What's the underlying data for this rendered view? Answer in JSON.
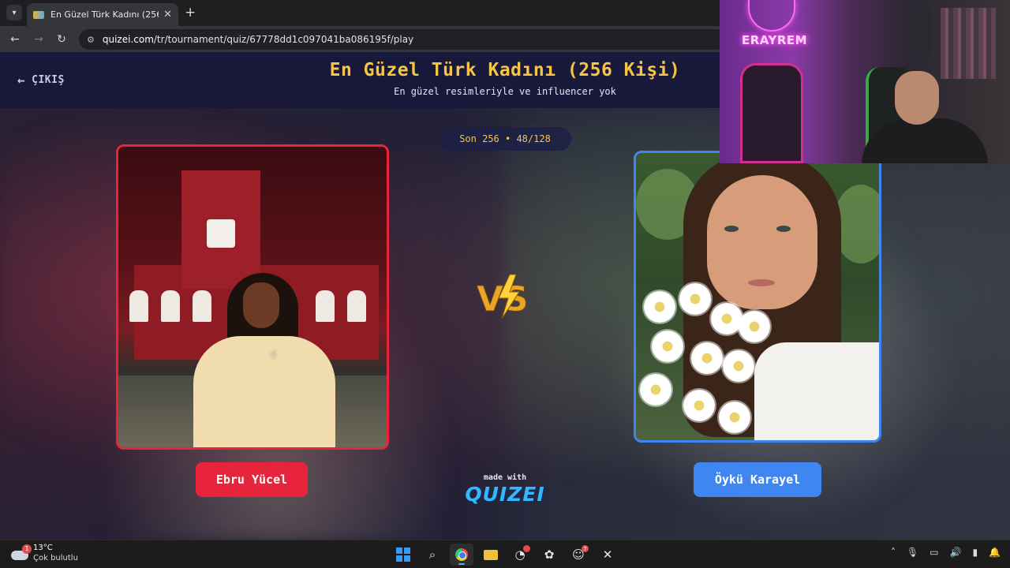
{
  "browser": {
    "tab_title": "En Güzel Türk Kadını (256 Kişi)",
    "url_host": "quizei.com",
    "url_path": "/tr/tournament/quiz/67778dd1c097041ba086195f/play"
  },
  "header": {
    "exit_label": "ÇIKIŞ",
    "title": "En Güzel Türk Kadını (256 Kişi)",
    "subtitle": "En güzel resimleriyle ve influencer yok"
  },
  "round": {
    "label": "Son 256 • 48/128"
  },
  "contestants": {
    "left": {
      "name": "Ebru Yücel",
      "accent": "#e8243c"
    },
    "right": {
      "name": "Öykü Karayel",
      "accent": "#3f86f0"
    }
  },
  "versus": {
    "text": "VS"
  },
  "footer": {
    "made_with": "made with",
    "brand": "QUIZEI"
  },
  "webcam": {
    "logo_text": "ERAYREM"
  },
  "taskbar": {
    "weather_badge": "1",
    "temperature": "13°C",
    "condition": "Çok bulutlu",
    "discord_badge": "7"
  },
  "colors": {
    "title": "#f6c544",
    "left_accent": "#e8243c",
    "right_accent": "#3f86f0",
    "header_bg": "#18183c"
  }
}
